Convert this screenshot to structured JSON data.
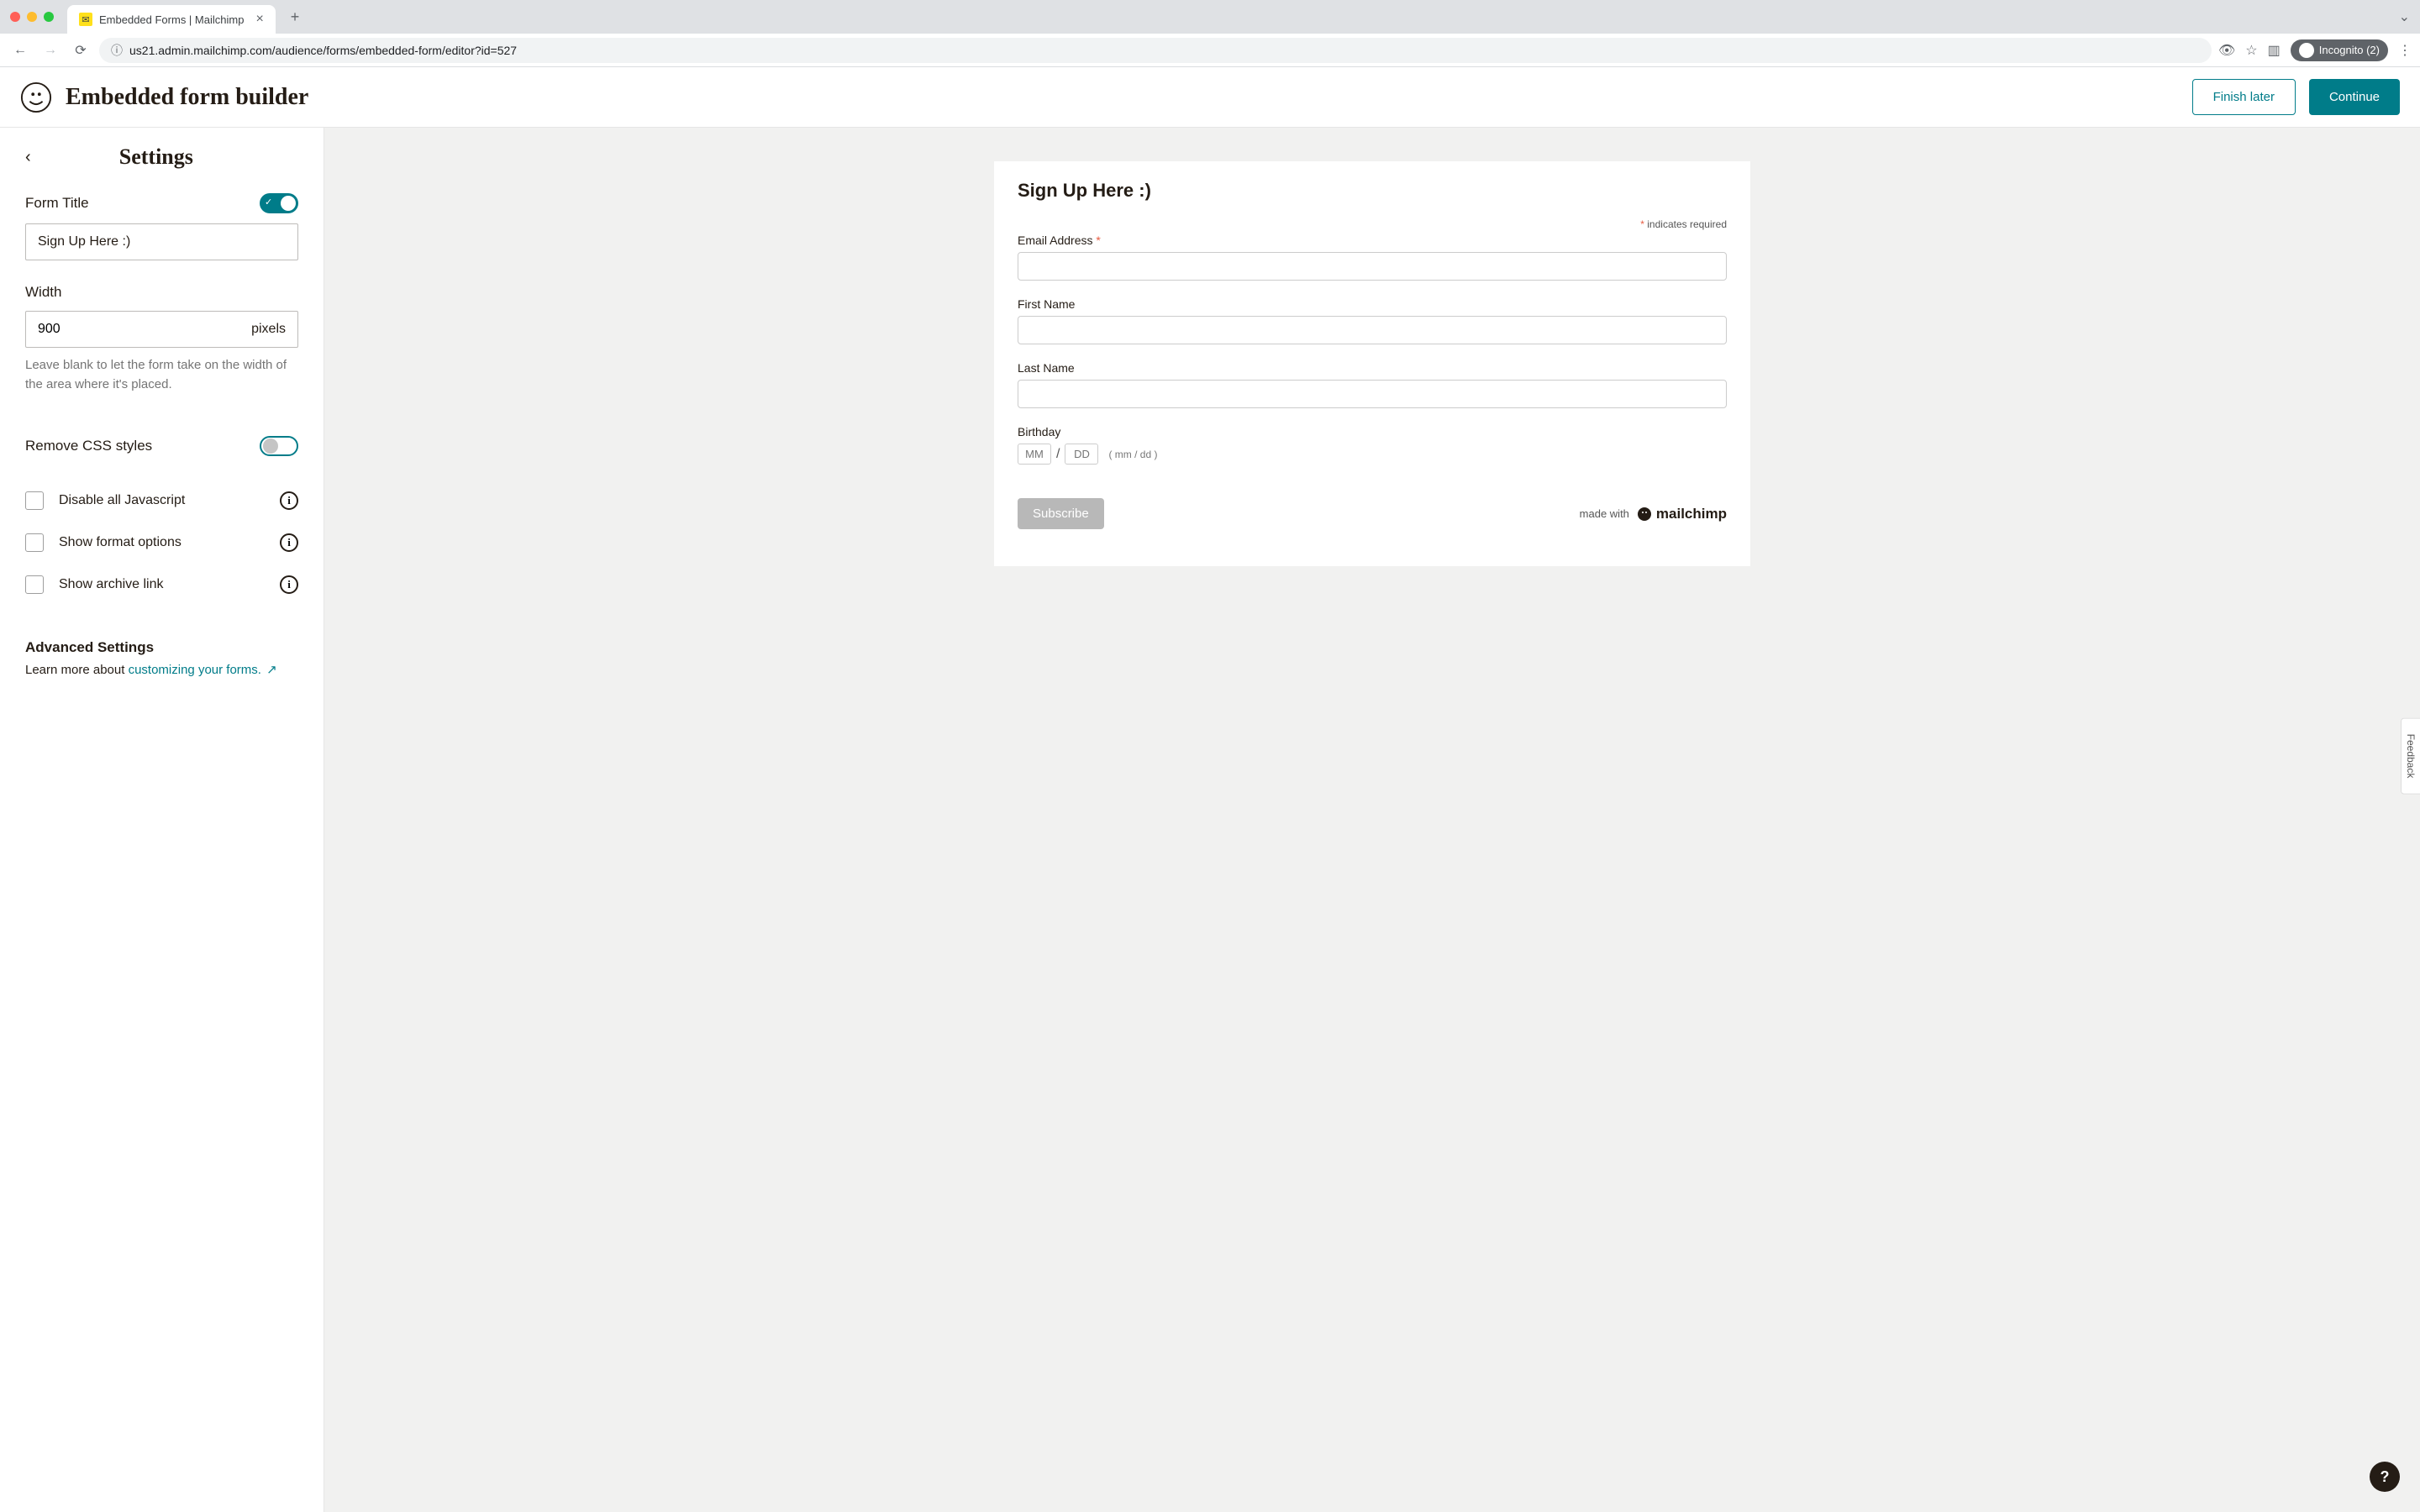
{
  "browser": {
    "tab_title": "Embedded Forms | Mailchimp",
    "url": "us21.admin.mailchimp.com/audience/forms/embedded-form/editor?id=527",
    "incognito_label": "Incognito (2)"
  },
  "header": {
    "title": "Embedded form builder",
    "finish_later": "Finish later",
    "continue": "Continue"
  },
  "sidebar": {
    "title": "Settings",
    "form_title_label": "Form Title",
    "form_title_value": "Sign Up Here :)",
    "width_label": "Width",
    "width_value": "900",
    "width_unit": "pixels",
    "width_help": "Leave blank to let the form take on the width of the area where it's placed.",
    "remove_css_label": "Remove CSS styles",
    "checkboxes": [
      {
        "label": "Disable all Javascript"
      },
      {
        "label": "Show format options"
      },
      {
        "label": "Show archive link"
      }
    ],
    "advanced_heading": "Advanced Settings",
    "advanced_desc_prefix": "Learn more about ",
    "advanced_link": "customizing your forms."
  },
  "preview": {
    "form_title": "Sign Up Here :)",
    "required_note": "indicates required",
    "fields": {
      "email": "Email Address",
      "first_name": "First Name",
      "last_name": "Last Name",
      "birthday": "Birthday"
    },
    "bd_mm": "MM",
    "bd_dd": "DD",
    "bd_hint": "( mm / dd )",
    "subscribe": "Subscribe",
    "made_with": "made with",
    "brand": "mailchimp"
  },
  "misc": {
    "feedback": "Feedback",
    "help": "?"
  }
}
